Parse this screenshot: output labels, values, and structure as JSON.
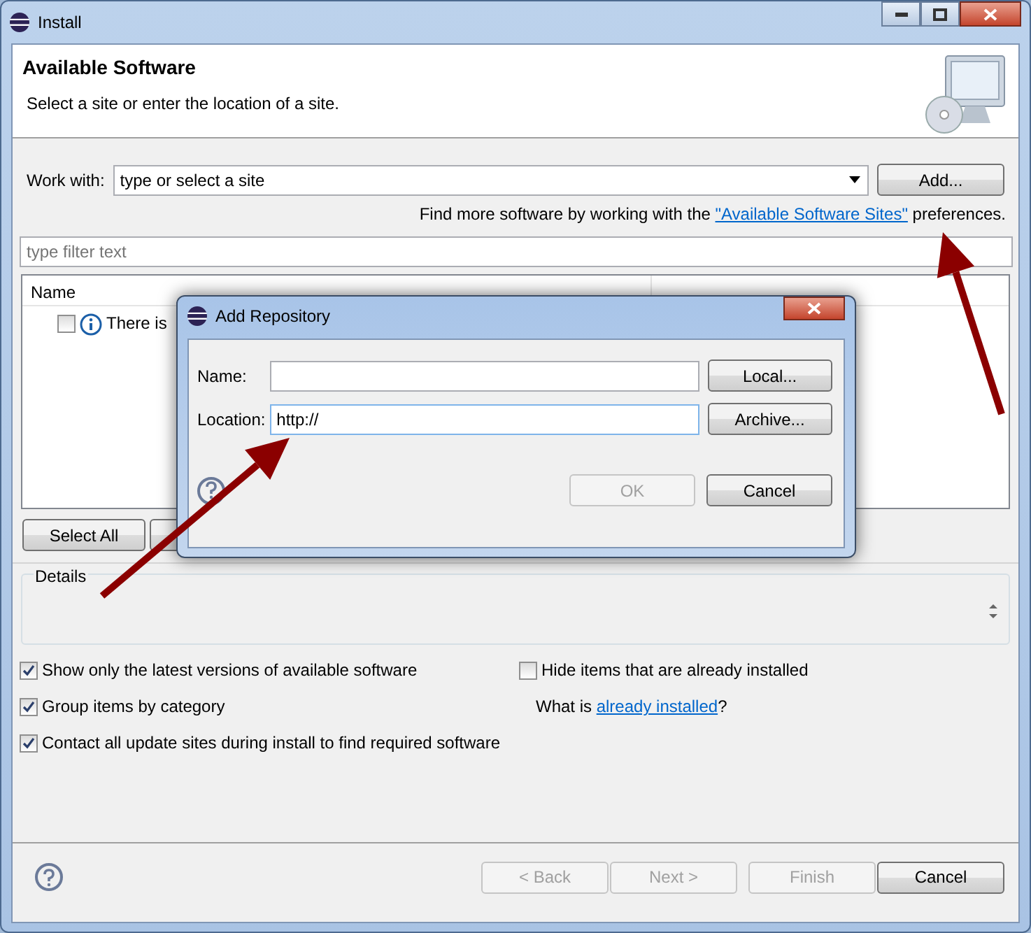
{
  "window": {
    "title": "Install"
  },
  "header": {
    "title": "Available Software",
    "subtitle": "Select a site or enter the location of a site."
  },
  "work_with": {
    "label": "Work with:",
    "placeholder": "type or select a site",
    "button": "Add..."
  },
  "sites_note": {
    "before": "Find more software by working with the",
    "link": "\"Available Software Sites\"",
    "after": "preferences."
  },
  "filter": {
    "placeholder": "type filter text"
  },
  "table": {
    "columns": [
      "Name"
    ],
    "rows": [
      {
        "checked": false,
        "text": "There is"
      }
    ]
  },
  "list_buttons": [
    {
      "label": "Select All"
    }
  ],
  "details": {
    "label": "Details"
  },
  "options_left": [
    {
      "label": "Show only the latest versions of available software",
      "checked": true
    },
    {
      "label": "Group items by category",
      "checked": true
    },
    {
      "label": "Contact all update sites during install to find required software",
      "checked": true
    }
  ],
  "options_right": {
    "label": "Hide items that are already installed",
    "checked": false,
    "before": "What is",
    "link": "already installed",
    "after": "?"
  },
  "footer_buttons": [
    {
      "label": "< Back",
      "disabled": true
    },
    {
      "label": "Next >",
      "disabled": true
    },
    {
      "label": "Finish",
      "disabled": true
    },
    {
      "label": "Cancel",
      "disabled": false
    }
  ],
  "dialog": {
    "title": "Add Repository",
    "fields": [
      {
        "label": "Name:",
        "button": "Local..."
      },
      {
        "label": "Location:",
        "value": "http://",
        "button": "Archive..."
      }
    ],
    "buttons": [
      {
        "label": "OK",
        "disabled": true
      },
      {
        "label": "Cancel",
        "disabled": false
      }
    ]
  }
}
